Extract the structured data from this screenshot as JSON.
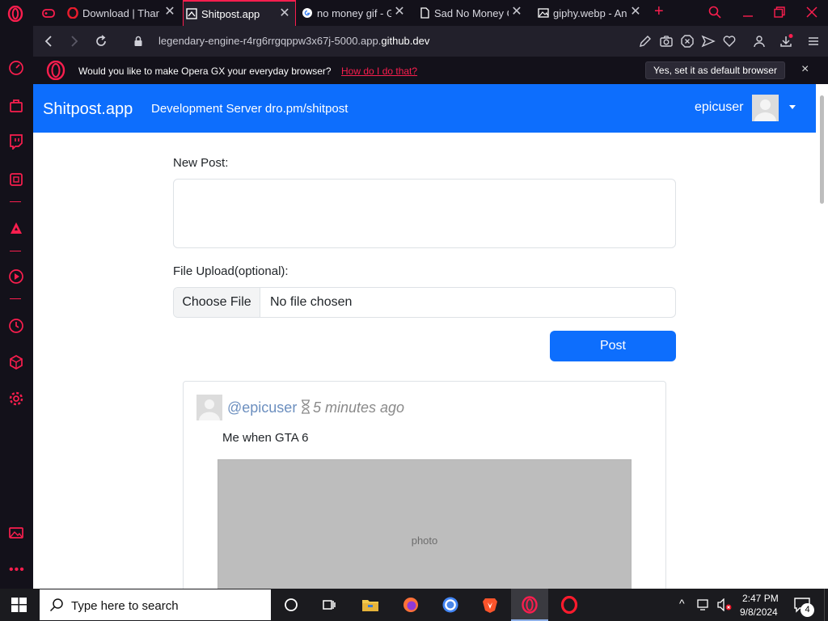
{
  "browser": {
    "tabs": [
      {
        "label": "Download | Than",
        "icon": "opera-icon",
        "active": false
      },
      {
        "label": "Shitpost.app",
        "icon": "page-icon",
        "active": true
      },
      {
        "label": "no money gif - G",
        "icon": "google-icon",
        "active": false
      },
      {
        "label": "Sad No Money G",
        "icon": "document-icon",
        "active": false
      },
      {
        "label": "giphy.webp - An",
        "icon": "image-icon",
        "active": false
      }
    ],
    "url_prefix": "legendary-engine-r4rg6rrgqppw3x67j-5000.app.",
    "url_domain": "github.dev",
    "infobar": {
      "text": "Would you like to make Opera GX your everyday browser?",
      "link": "How do I do that?",
      "button": "Yes, set it as default browser"
    }
  },
  "app": {
    "brand": "Shitpost.app",
    "server": "Development Server dro.pm/shitpost",
    "user": "epicuser",
    "new_post_label": "New Post:",
    "new_post_value": "",
    "upload_label": "File Upload(optional):",
    "choose_file": "Choose File",
    "file_status": "No file chosen",
    "post_button": "Post",
    "post": {
      "user": "@epicuser",
      "time": "5 minutes ago",
      "text": "Me when GTA 6",
      "image_alt": "photo"
    }
  },
  "taskbar": {
    "search_placeholder": "Type here to search",
    "time": "2:47 PM",
    "date": "9/8/2024",
    "notifications": "4"
  },
  "colors": {
    "accent": "#fa1e4e",
    "navbar": "#0d6efd",
    "browser_bg": "#13111a"
  }
}
